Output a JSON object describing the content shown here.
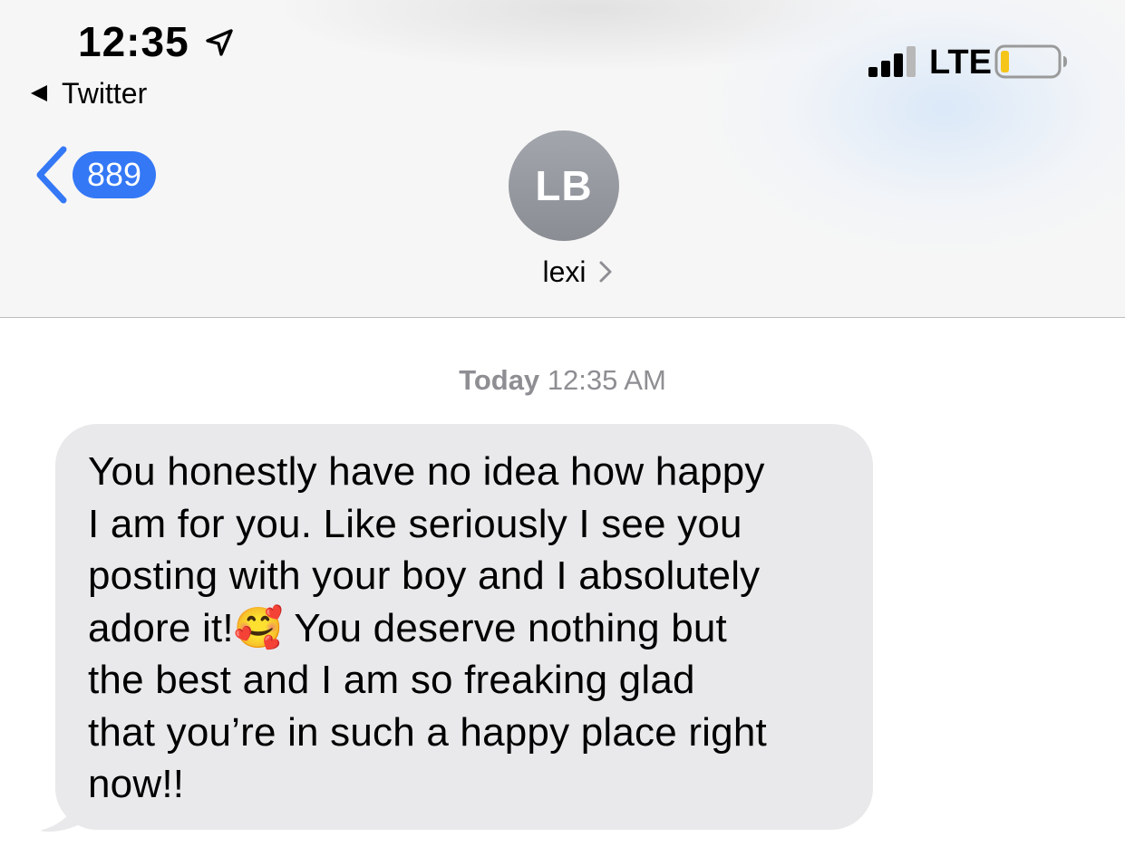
{
  "status_bar": {
    "time": "12:35",
    "back_app_label": "Twitter",
    "network": "LTE",
    "battery_color": "#f5c518"
  },
  "nav": {
    "unread_count": "889",
    "contact_initials": "LB",
    "contact_name": "lexi",
    "accent_color": "#3478f6"
  },
  "conversation": {
    "timestamp_day": "Today",
    "timestamp_time": "12:35 AM",
    "messages": [
      {
        "direction": "incoming",
        "text": "You honestly have no idea how happy\nI am for you. Like seriously I see you\nposting with your boy and I absolutely\nadore it!🥰  You deserve nothing but\nthe best and I am so freaking glad\nthat you’re in such a happy place right\nnow!!"
      }
    ]
  }
}
